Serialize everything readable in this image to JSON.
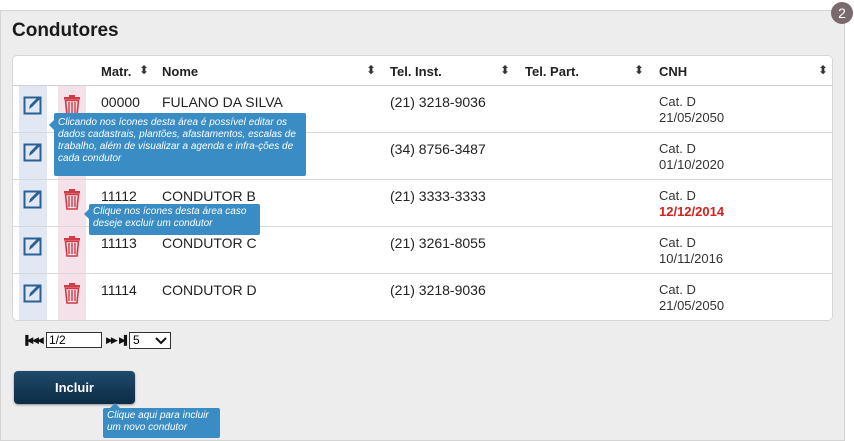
{
  "page": {
    "title": "Condutores",
    "badge": "2"
  },
  "table": {
    "headers": {
      "matr": "Matr.",
      "nome": "Nome",
      "tel_inst": "Tel. Inst.",
      "tel_part": "Tel. Part.",
      "cnh": "CNH",
      "sort_icon": "⬍"
    },
    "rows": [
      {
        "matr": "00000",
        "nome": "FULANO DA SILVA",
        "tel_inst": "(21) 3218-9036",
        "tel_part": "",
        "cnh_cat": "Cat. D",
        "cnh_date": "21/05/2050",
        "expired": false
      },
      {
        "matr": "",
        "nome": "",
        "tel_inst": "(34) 8756-3487",
        "tel_part": "",
        "cnh_cat": "Cat. D",
        "cnh_date": "01/10/2020",
        "expired": false
      },
      {
        "matr": "11112",
        "nome": "CONDUTOR B",
        "tel_inst": "(21) 3333-3333",
        "tel_part": "",
        "cnh_cat": "Cat. D",
        "cnh_date": "12/12/2014",
        "expired": true
      },
      {
        "matr": "11113",
        "nome": "CONDUTOR C",
        "tel_inst": "(21) 3261-8055",
        "tel_part": "",
        "cnh_cat": "Cat. D",
        "cnh_date": "10/11/2016",
        "expired": false
      },
      {
        "matr": "11114",
        "nome": "CONDUTOR D",
        "tel_inst": "(21) 3218-9036",
        "tel_part": "",
        "cnh_cat": "Cat. D",
        "cnh_date": "21/05/2050",
        "expired": false
      }
    ]
  },
  "pager": {
    "first": "⏮",
    "prev": "◀◀",
    "page_value": "1/2",
    "next": "▶▶",
    "last": "⏭",
    "page_size": "5"
  },
  "actions": {
    "incluir_label": "Incluir"
  },
  "tooltips": {
    "edit_tip": "Clicando nos ícones desta área é possível editar os dados cadastrais, plantões, afastamentos, escalas de trabalho, além de visualizar a agenda e infra-ções de cada condutor",
    "delete_tip": "Clique nos ícones desta área caso deseje excluir um condutor",
    "incluir_tip": "Clique aqui para incluir um novo condutor"
  },
  "colors": {
    "edit_icon": "#2a5f95",
    "delete_icon": "#d23a45",
    "expired_date": "#d62020",
    "tooltip": "#3a8cc4",
    "button": "#0f3553"
  },
  "icons": {
    "edit": "edit-icon",
    "delete": "trash-icon"
  }
}
